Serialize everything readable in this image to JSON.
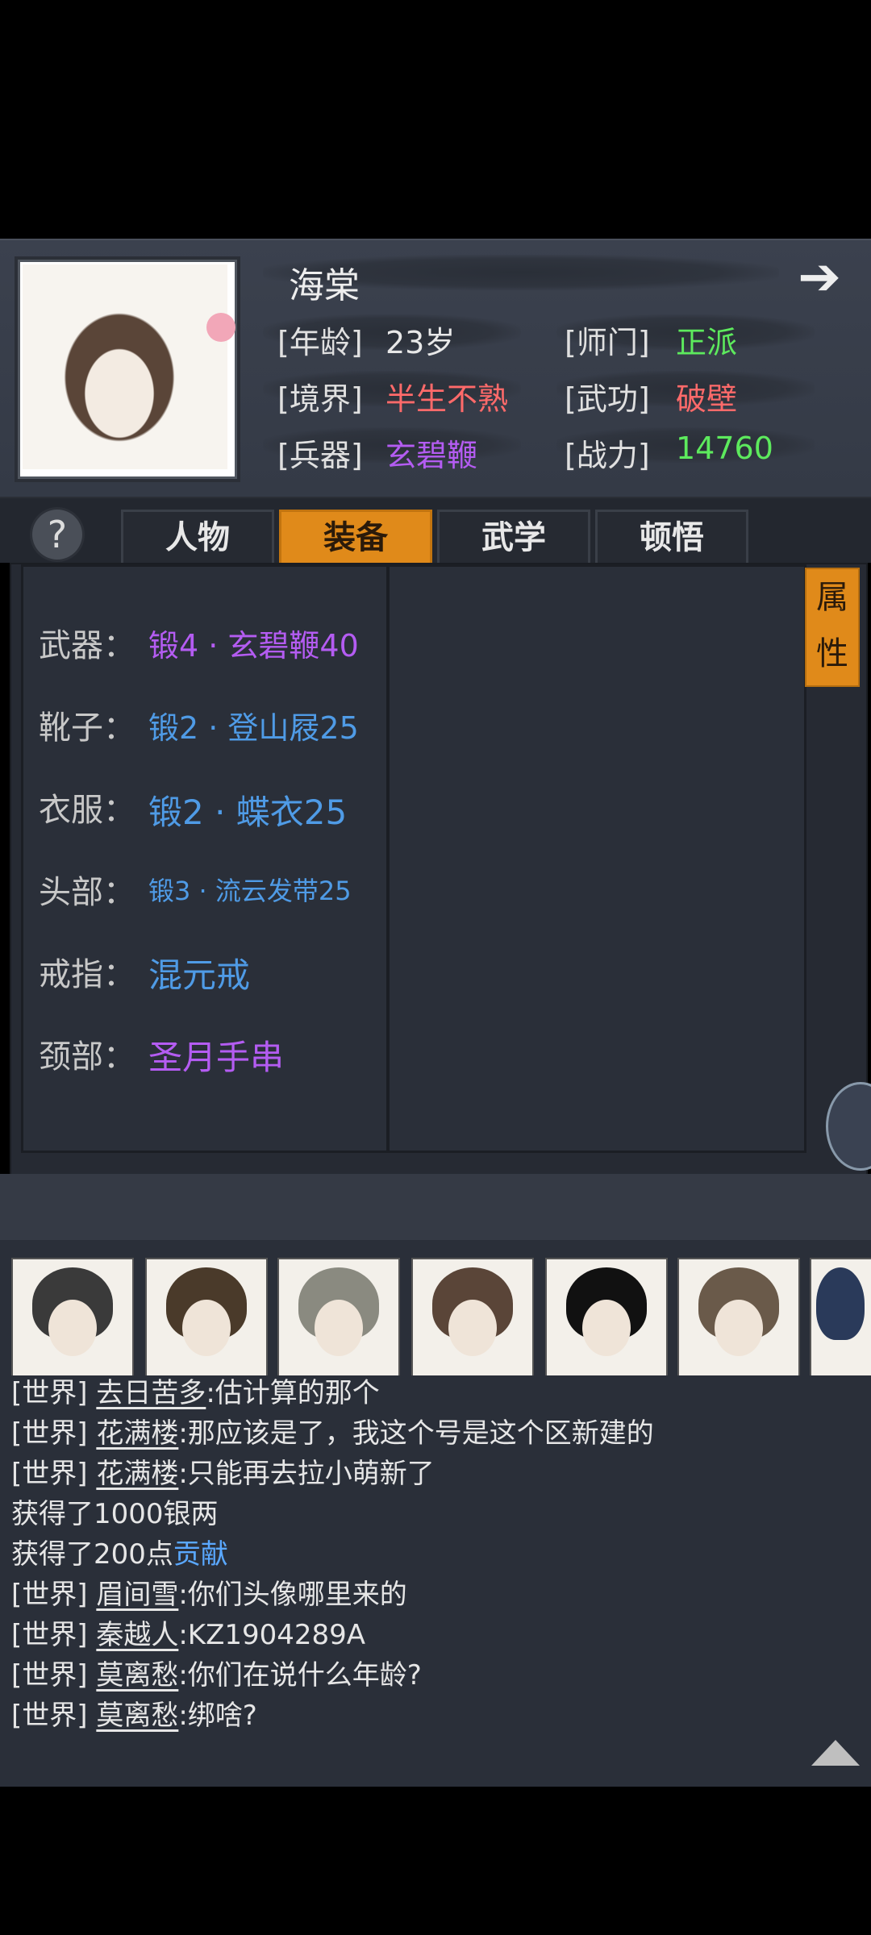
{
  "header": {
    "name": "海棠",
    "stats": [
      {
        "label": "[年龄]",
        "value": "23岁",
        "color": "#e8e8e8"
      },
      {
        "label": "[师门]",
        "value": "正派",
        "color": "#5dea5d"
      },
      {
        "label": "[境界]",
        "value": "半生不熟",
        "color": "#ff6a6a"
      },
      {
        "label": "[武功]",
        "value": "破壁",
        "color": "#ff6a6a"
      },
      {
        "label": "[兵器]",
        "value": "玄碧鞭",
        "color": "#b45cf2"
      },
      {
        "label": "[战力]",
        "value": "14760",
        "color": "#5dea5d"
      }
    ]
  },
  "help_label": "?",
  "tabs": [
    "人物",
    "装备",
    "武学",
    "顿悟"
  ],
  "active_tab": "装备",
  "attr_button": [
    "属",
    "性"
  ],
  "equipment": [
    {
      "slot": "武器：",
      "item": "锻4 · 玄碧鞭40",
      "color": "#b45cf2"
    },
    {
      "slot": "靴子：",
      "item": "锻2 · 登山屐25",
      "color": "#4f9be6"
    },
    {
      "slot": "衣服：",
      "item": "锻2 · 蝶衣25",
      "color": "#4f9be6"
    },
    {
      "slot": "头部：",
      "item": "锻3 · 流云发带25",
      "color": "#4f9be6"
    },
    {
      "slot": "戒指：",
      "item": "混元戒",
      "color": "#4f9be6"
    },
    {
      "slot": "颈部：",
      "item": "圣月手串",
      "color": "#b45cf2"
    }
  ],
  "chat": [
    {
      "channel": "[世界]",
      "user": "去日苦多",
      "text": ":估计算的那个"
    },
    {
      "channel": "[世界]",
      "user": "花满楼",
      "text": ":那应该是了，我这个号是这个区新建的"
    },
    {
      "channel": "[世界]",
      "user": "花满楼",
      "text": ":只能再去拉小萌新了"
    },
    {
      "plain": "获得了1000",
      "tail": "银两",
      "tail_color": "#e6e6e6"
    },
    {
      "plain": "获得了200点",
      "tail": "贡献",
      "tail_color": "#5aa8ff"
    },
    {
      "channel": "[世界]",
      "user": "眉间雪",
      "text": ":你们头像哪里来的"
    },
    {
      "channel": "[世界]",
      "user": "秦越人",
      "text": ":KZ1904289A"
    },
    {
      "channel": "[世界]",
      "user": "莫离愁",
      "text": ":你们在说什么年龄?"
    },
    {
      "channel": "[世界]",
      "user": "莫离愁",
      "text": ":绑啥?"
    }
  ]
}
